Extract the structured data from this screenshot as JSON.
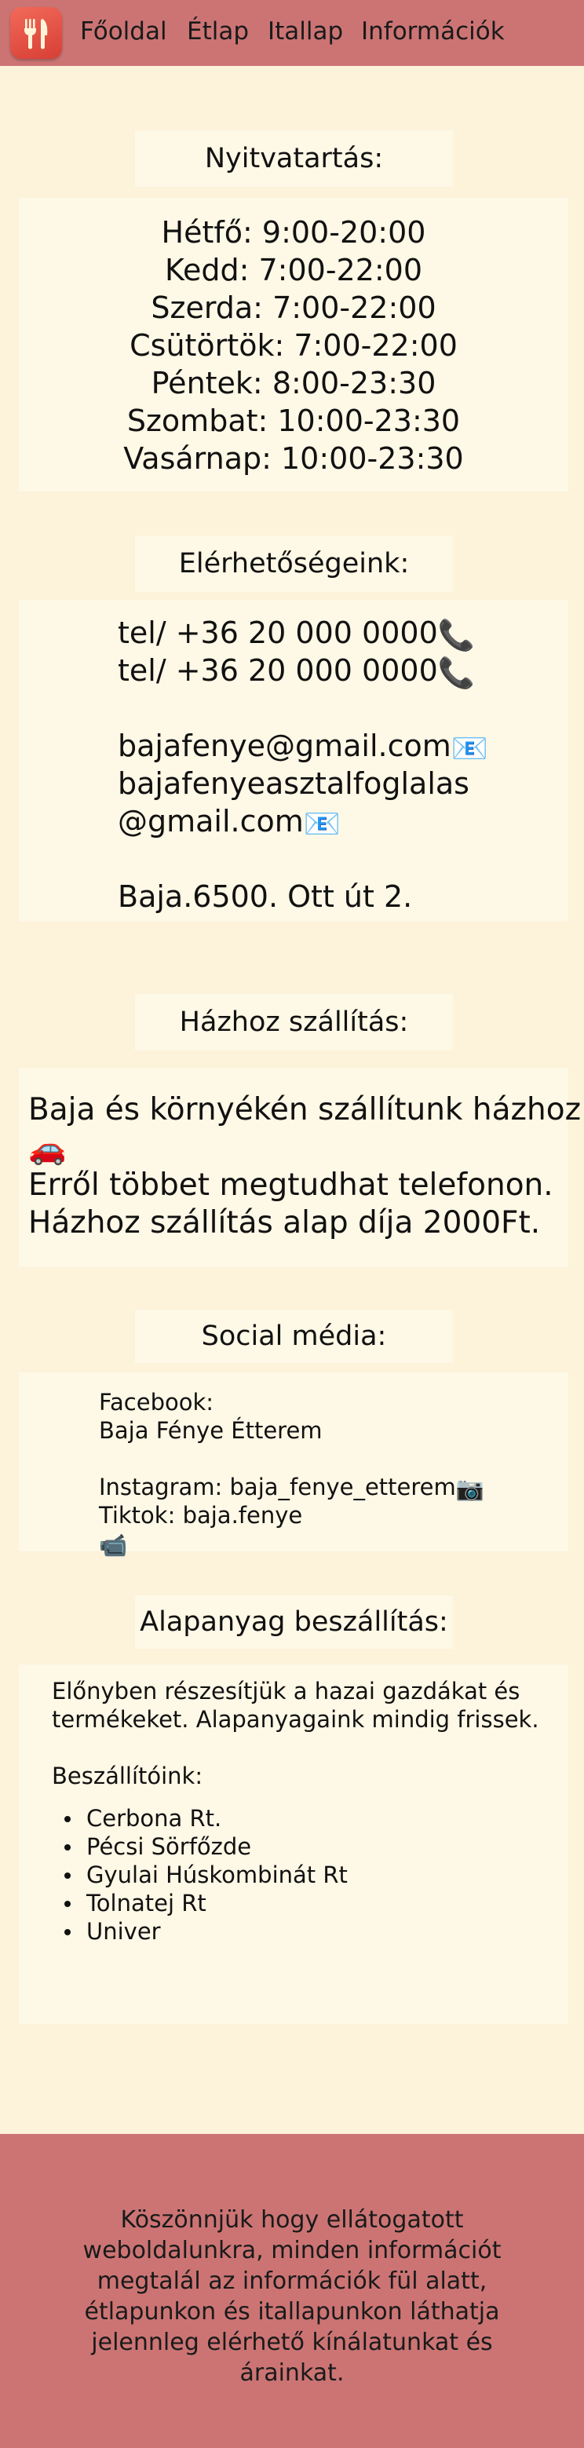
{
  "nav": {
    "logo_icon": "fork-knife-icon",
    "links": [
      "Főoldal",
      "Étlap",
      "Itallap",
      "Információk"
    ]
  },
  "hours": {
    "title": "Nyitvatartás:",
    "lines": [
      "Hétfő: 9:00-20:00",
      "Kedd: 7:00-22:00",
      "Szerda: 7:00-22:00",
      "Csütörtök: 7:00-22:00",
      "Péntek: 8:00-23:30",
      "Szombat: 10:00-23:30",
      "Vasárnap: 10:00-23:30"
    ]
  },
  "contact": {
    "title": "Elérhetőségeink:",
    "phone1": "tel/ +36 20 000 0000",
    "phone2": "tel/ +36 20 000 0000",
    "email1": "bajafenye@gmail.com",
    "email2_line1": "bajafenyeasztalfoglalas",
    "email2_line2": "@gmail.com",
    "address": "Baja.6500. Ott út 2."
  },
  "delivery": {
    "title": "Házhoz szállítás:",
    "line1": "Baja és környékén szállítunk házhoz.",
    "line2": "Erről többet megtudhat telefonon.",
    "line3": "Házhoz szállítás alap díja 2000Ft."
  },
  "social": {
    "title": "Social média:",
    "facebook_label": "Facebook:",
    "facebook_name": "Baja Fénye Étterem",
    "instagram": "Instagram: baja_fenye_etterem",
    "tiktok": "Tiktok: baja.fenye"
  },
  "supply": {
    "title": "Alapanyag beszállítás:",
    "intro_line1": "Előnyben részesítjük a hazai gazdákat és",
    "intro_line2": "termékeket. Alapanyagaink mindig frissek.",
    "suppliers_label": "Beszállítóink:",
    "suppliers": [
      "Cerbona Rt.",
      "Pécsi Sörfőzde",
      "Gyulai Húskombinát Rt",
      "Tolnatej Rt",
      "Univer"
    ]
  },
  "footer": {
    "text": "Köszönnjük hogy ellátogatott weboldalunkra, minden információt megtalál az információk fül alatt, étlapunkon és itallapunkon láthatja jelennleg elérhető kínálatunkat és árainkat."
  },
  "colors": {
    "background": "#fdf2da",
    "panel": "#fef8e6",
    "nav": "#cc7474",
    "footer": "#cc7474",
    "logo": "#e2493d"
  }
}
